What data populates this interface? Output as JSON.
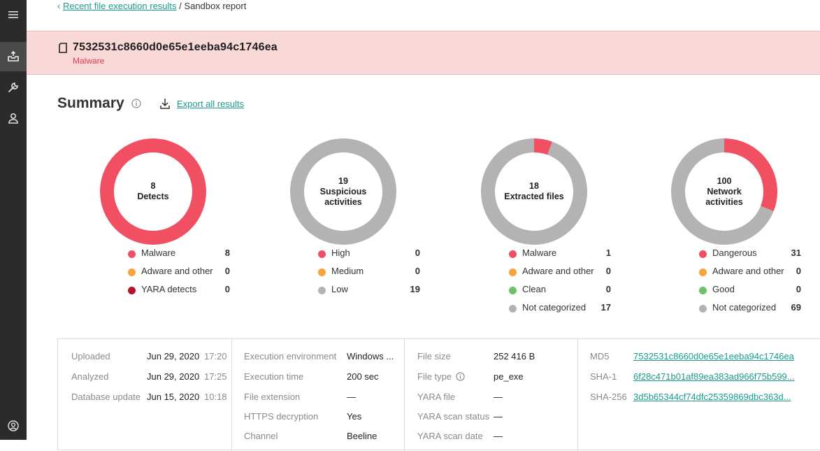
{
  "breadcrumb": {
    "back_link": "Recent file execution results",
    "separator": "/",
    "current": "Sandbox report"
  },
  "file": {
    "hash": "7532531c8660d0e65e1eeba94c1746ea",
    "verdict": "Malware"
  },
  "summary": {
    "title": "Summary",
    "export_label": "Export all results"
  },
  "charts": [
    {
      "center_number": "8",
      "center_line1": "Detects",
      "center_line2": "",
      "segments": [
        {
          "value": 8,
          "color": "#f05062"
        }
      ],
      "legend": [
        {
          "label": "Malware",
          "count": "8",
          "color": "#f05062"
        },
        {
          "label": "Adware and other",
          "count": "0",
          "color": "#f6a33a"
        },
        {
          "label": "YARA detects",
          "count": "0",
          "color": "#b5152b"
        }
      ]
    },
    {
      "center_number": "19",
      "center_line1": "Suspicious",
      "center_line2": "activities",
      "segments": [
        {
          "value": 19,
          "color": "#b3b3b3"
        }
      ],
      "legend": [
        {
          "label": "High",
          "count": "0",
          "color": "#f05062"
        },
        {
          "label": "Medium",
          "count": "0",
          "color": "#f6a33a"
        },
        {
          "label": "Low",
          "count": "19",
          "color": "#b3b3b3"
        }
      ]
    },
    {
      "center_number": "18",
      "center_line1": "Extracted files",
      "center_line2": "",
      "segments": [
        {
          "value": 1,
          "color": "#f05062"
        },
        {
          "value": 17,
          "color": "#b3b3b3"
        }
      ],
      "legend": [
        {
          "label": "Malware",
          "count": "1",
          "color": "#f05062"
        },
        {
          "label": "Adware and other",
          "count": "0",
          "color": "#f6a33a"
        },
        {
          "label": "Clean",
          "count": "0",
          "color": "#6cc16a"
        },
        {
          "label": "Not categorized",
          "count": "17",
          "color": "#b3b3b3"
        }
      ]
    },
    {
      "center_number": "100",
      "center_line1": "Network",
      "center_line2": "activities",
      "segments": [
        {
          "value": 31,
          "color": "#f05062"
        },
        {
          "value": 69,
          "color": "#b3b3b3"
        }
      ],
      "legend": [
        {
          "label": "Dangerous",
          "count": "31",
          "color": "#f05062"
        },
        {
          "label": "Adware and other",
          "count": "0",
          "color": "#f6a33a"
        },
        {
          "label": "Good",
          "count": "0",
          "color": "#6cc16a"
        },
        {
          "label": "Not categorized",
          "count": "69",
          "color": "#b3b3b3"
        }
      ]
    }
  ],
  "details": {
    "dates": [
      {
        "key": "Uploaded",
        "date": "Jun 29, 2020",
        "time": "17:20"
      },
      {
        "key": "Analyzed",
        "date": "Jun 29, 2020",
        "time": "17:25"
      },
      {
        "key": "Database update",
        "date": "Jun 15, 2020",
        "time": "10:18"
      }
    ],
    "execution": [
      {
        "key": "Execution environment",
        "value": "Windows ..."
      },
      {
        "key": "Execution time",
        "value": "200 sec"
      },
      {
        "key": "File extension",
        "value": "—"
      },
      {
        "key": "HTTPS decryption",
        "value": "Yes"
      },
      {
        "key": "Channel",
        "value": "Beeline"
      }
    ],
    "file_info": [
      {
        "key": "File size",
        "value": "252 416 B"
      },
      {
        "key": "File type",
        "value": "pe_exe"
      },
      {
        "key": "YARA file",
        "value": "—"
      },
      {
        "key": "YARA scan status",
        "value": "—"
      },
      {
        "key": "YARA scan date",
        "value": "—"
      }
    ],
    "hashes": [
      {
        "key": "MD5",
        "value": "7532531c8660d0e65e1eeba94c1746ea"
      },
      {
        "key": "SHA-1",
        "value": "6f28c471b01af89ea383ad966f75b599..."
      },
      {
        "key": "SHA-256",
        "value": "3d5b65344cf74dfc25359869dbc363d..."
      }
    ]
  }
}
